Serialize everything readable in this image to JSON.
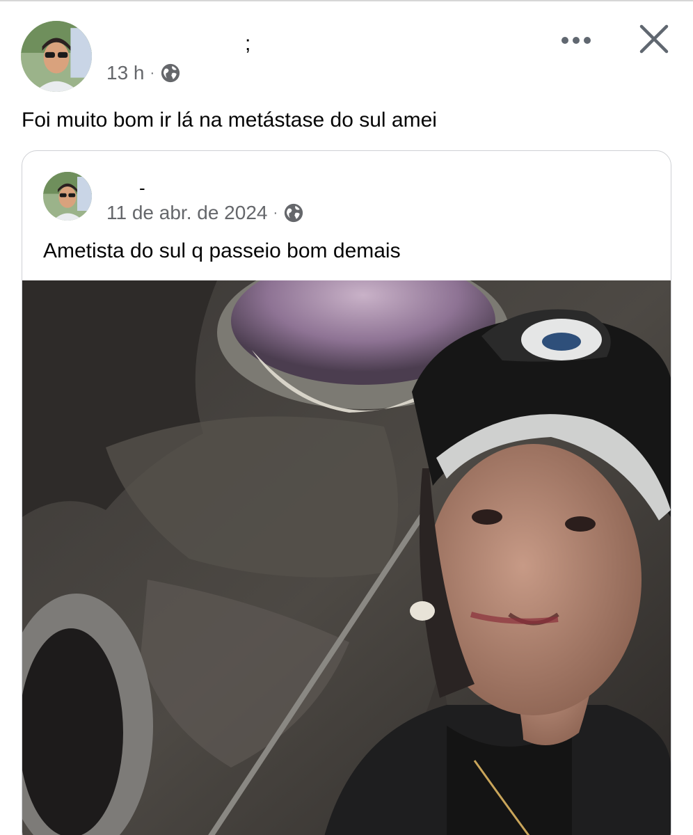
{
  "post": {
    "author_name": ";",
    "time": "13 h",
    "separator": "·",
    "privacy_icon": "globe-icon",
    "text": "Foi muito bom ir lá na metástase do sul amei",
    "actions": {
      "more_icon": "more-icon",
      "close_icon": "close-icon"
    }
  },
  "shared_post": {
    "author_name": "-",
    "date": "11 de abr. de 2024",
    "separator": "·",
    "privacy_icon": "globe-icon",
    "text": "Ametista do sul q passeio bom demais",
    "photo_icon": "photo-amethyst-mine-selfie"
  },
  "colors": {
    "text_primary": "#050505",
    "text_secondary": "#65676b",
    "card_border": "#ced0d4",
    "icon_gray": "#606770"
  }
}
